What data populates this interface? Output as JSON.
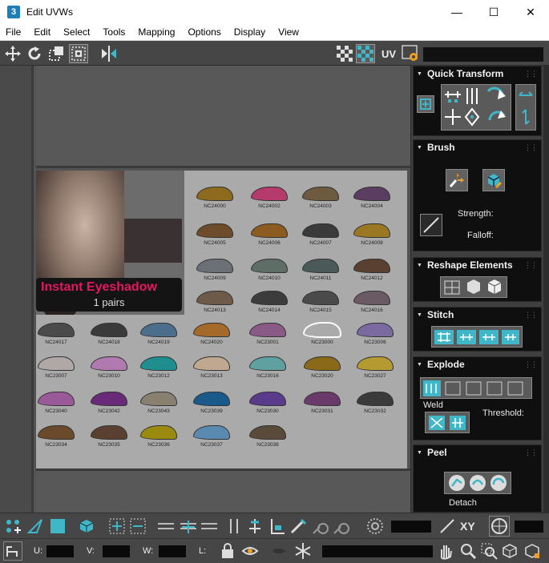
{
  "window": {
    "app_icon_text": "3",
    "title": "Edit UVWs",
    "minimize": "—",
    "maximize": "☐",
    "close": "✕"
  },
  "menu": [
    "File",
    "Edit",
    "Select",
    "Tools",
    "Mapping",
    "Options",
    "Display",
    "View"
  ],
  "toolbar": {
    "uv_label": "UV",
    "icons": [
      "move-icon",
      "rotate-icon",
      "scale-icon",
      "freeform-icon",
      "mirror-icon",
      "checker-pattern-icon",
      "checker-map-icon",
      "uv-toggle-icon",
      "settings-icon"
    ]
  },
  "texture": {
    "promo_title": "Instant Eyeshadow",
    "promo_sub": "1 pairs",
    "patterns": [
      {
        "label": "NC24000",
        "color": "#8d6a1e"
      },
      {
        "label": "NC24002",
        "color": "#b43b6b"
      },
      {
        "label": "NC24003",
        "color": "#6e5a3e"
      },
      {
        "label": "NC24004",
        "color": "#5a3d60"
      },
      {
        "label": "NC24005",
        "color": "#6e4b2a"
      },
      {
        "label": "NC24006",
        "color": "#8c5b20"
      },
      {
        "label": "NC24007",
        "color": "#3a3a3a"
      },
      {
        "label": "NC24008",
        "color": "#9a7722"
      },
      {
        "label": "NC24009",
        "color": "#6b7077"
      },
      {
        "label": "NC24010",
        "color": "#5e6e66"
      },
      {
        "label": "NC24011",
        "color": "#4b5a58"
      },
      {
        "label": "NC24012",
        "color": "#5a4030"
      },
      {
        "label": "NC24013",
        "color": "#6e5a48"
      },
      {
        "label": "NC24014",
        "color": "#3c3c3c"
      },
      {
        "label": "NC24015",
        "color": "#4a4a4a"
      },
      {
        "label": "NC24016",
        "color": "#6a5a64"
      },
      {
        "label": "NC24017",
        "color": "#4a4a4a"
      },
      {
        "label": "NC24018",
        "color": "#3a3a3a"
      },
      {
        "label": "NC24019",
        "color": "#4a6e8c"
      },
      {
        "label": "NC24020",
        "color": "#a56a2a"
      },
      {
        "label": "NC23001",
        "color": "#8a5a86"
      },
      {
        "label": "NC23000",
        "color": "#aaaaaa"
      },
      {
        "label": "NC23006",
        "color": "#7a6aa0"
      },
      {
        "label": "NC23007",
        "color": "#b0a8a6"
      },
      {
        "label": "NC23010",
        "color": "#b07ab0"
      },
      {
        "label": "NC23012",
        "color": "#1e8e8e"
      },
      {
        "label": "NC23013",
        "color": "#c0a890"
      },
      {
        "label": "NC23016",
        "color": "#60a0a0"
      },
      {
        "label": "NC23020",
        "color": "#8a6a18"
      },
      {
        "label": "NC23027",
        "color": "#b49a30"
      },
      {
        "label": "NC23040",
        "color": "#9a5a9a"
      },
      {
        "label": "NC23042",
        "color": "#6a2a7a"
      },
      {
        "label": "NC23043",
        "color": "#8a8070"
      },
      {
        "label": "NC23039",
        "color": "#1a5a8a"
      },
      {
        "label": "NC23030",
        "color": "#5a3a8a"
      },
      {
        "label": "NC23031",
        "color": "#6a3a6a"
      },
      {
        "label": "NC23032",
        "color": "#3a3a3a"
      },
      {
        "label": "NC23034",
        "color": "#6a4a2a"
      },
      {
        "label": "NC23035",
        "color": "#5a4030"
      },
      {
        "label": "NC23036",
        "color": "#9a8a10"
      },
      {
        "label": "NC23037",
        "color": "#5a8ab0"
      },
      {
        "label": "NC23038",
        "color": "#5a4a3a"
      }
    ]
  },
  "panel": {
    "quick_transform": {
      "title": "Quick Transform"
    },
    "brush": {
      "title": "Brush",
      "strength_label": "Strength:",
      "falloff_label": "Falloff:"
    },
    "reshape": {
      "title": "Reshape Elements"
    },
    "stitch": {
      "title": "Stitch"
    },
    "explode": {
      "title": "Explode",
      "weld_label": "Weld",
      "threshold_label": "Threshold:"
    },
    "peel": {
      "title": "Peel",
      "detach_label": "Detach"
    }
  },
  "bottom": {
    "xy_label": "XY",
    "u_label": "U:",
    "v_label": "V:",
    "w_label": "W:",
    "l_label": "L:"
  },
  "colors": {
    "accent": "#3fb7c8",
    "panel_bg": "#0f0f0f",
    "toolbar_bg": "#464646"
  }
}
